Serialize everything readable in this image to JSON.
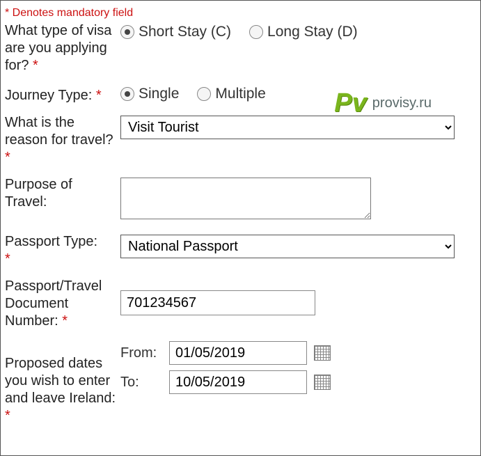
{
  "mandatory_note": "* Denotes mandatory field",
  "visa_type": {
    "label": "What type of visa are you applying for?",
    "options": {
      "short": "Short Stay (C)",
      "long": "Long Stay (D)"
    },
    "selected": "short"
  },
  "journey_type": {
    "label": "Journey Type:",
    "options": {
      "single": "Single",
      "multiple": "Multiple"
    },
    "selected": "single"
  },
  "reason": {
    "label": "What is the reason for travel?",
    "value": "Visit Tourist"
  },
  "purpose": {
    "label": "Purpose of Travel:",
    "value": ""
  },
  "passport_type": {
    "label": "Passport Type:",
    "value": "National Passport"
  },
  "passport_number": {
    "label": "Passport/Travel Document Number:",
    "value": "701234567"
  },
  "dates": {
    "label": "Proposed dates you wish to enter and leave Ireland:",
    "from_label": "From:",
    "to_label": "To:",
    "from": "01/05/2019",
    "to": "10/05/2019"
  },
  "logo": {
    "mark": "Pv",
    "text": "provisy.ru"
  }
}
